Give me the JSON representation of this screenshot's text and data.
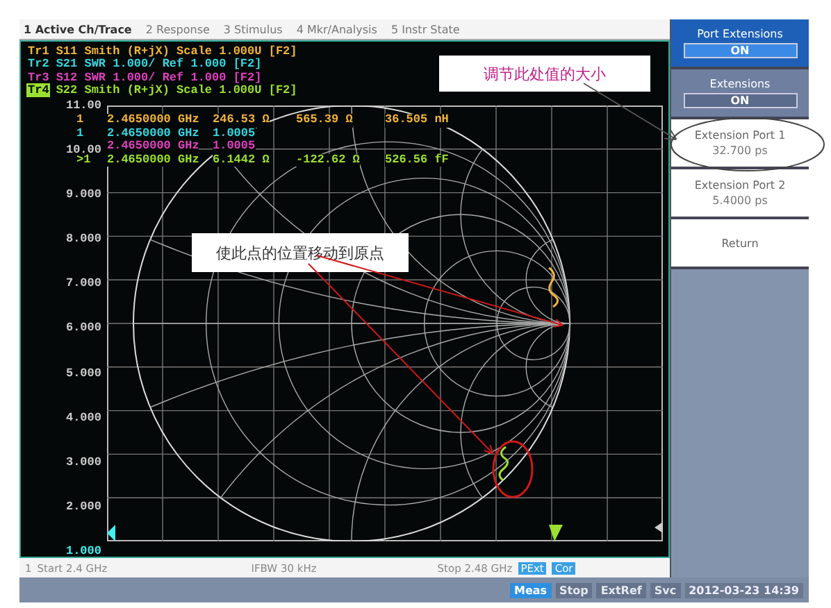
{
  "menu": [
    {
      "label": "1 Active Ch/Trace",
      "selected": true
    },
    {
      "label": "2 Response",
      "selected": false
    },
    {
      "label": "3 Stimulus",
      "selected": false
    },
    {
      "label": "4 Mkr/Analysis",
      "selected": false
    },
    {
      "label": "5 Instr State",
      "selected": false
    }
  ],
  "traces": [
    {
      "label": "Tr1",
      "text": "S11 Smith (R+jX) Scale 1.000U [F2]",
      "color": "#f2b43c",
      "selected": false
    },
    {
      "label": "Tr2",
      "text": "S21 SWR 1.000/ Ref 1.000 [F2]",
      "color": "#38d6e0",
      "selected": false
    },
    {
      "label": "Tr3",
      "text": "S12 SWR 1.000/ Ref 1.000 [F2]",
      "color": "#e040c0",
      "selected": false
    },
    {
      "label": "Tr4",
      "text": "S22 Smith (R+jX) Scale 1.000U [F2]",
      "color": "#9be030",
      "selected": true
    }
  ],
  "y_axis_labels": [
    "11.00",
    "10.00",
    "9.000",
    "8.000",
    "7.000",
    "6.000",
    "5.000",
    "4.000",
    "3.000",
    "2.000",
    "1.000"
  ],
  "markers": [
    {
      "id": "1",
      "color": "#f2b43c",
      "values": [
        "2.4650000 GHz",
        "246.53 Ω",
        "565.39 Ω",
        "36.505 nH"
      ]
    },
    {
      "id": "1",
      "color": "#38d6e0",
      "values": [
        "2.4650000 GHz",
        "1.0005"
      ]
    },
    {
      "color": "#e040c0",
      "values": [
        "2.4650000 GHz",
        "1.0005"
      ]
    },
    {
      "id": ">1",
      "color": "#9be030",
      "values": [
        "2.4650000 GHz",
        "6.1442 Ω",
        "-122.62 Ω",
        "526.56 fF"
      ]
    }
  ],
  "annotations": [
    {
      "kind": "top",
      "text": "调节此处值的大小"
    },
    {
      "kind": "middle",
      "text": "使此点的位置移动到原点"
    }
  ],
  "softkeys": [
    {
      "kind": "header",
      "label": "Port Extensions",
      "value": "ON"
    },
    {
      "kind": "toggle",
      "label": "Extensions",
      "value": "ON"
    },
    {
      "kind": "value",
      "label": "Extension Port 1",
      "value": "32.700 ps"
    },
    {
      "kind": "value",
      "label": "Extension Port 2",
      "value": "5.4000 ps"
    },
    {
      "kind": "plain",
      "label": "Return"
    }
  ],
  "status_line": {
    "channel": "1",
    "start": "Start 2.4 GHz",
    "ifbw": "IFBW 30 kHz",
    "stop": "Stop 2.48 GHz",
    "badges": [
      "PExt",
      "Cor"
    ]
  },
  "bottom_bar": {
    "items": [
      {
        "label": "Meas",
        "active": true
      },
      {
        "label": "Stop",
        "active": false
      },
      {
        "label": "ExtRef",
        "active": false
      },
      {
        "label": "Svc",
        "active": false
      }
    ],
    "datetime": "2012-03-23 14:39"
  }
}
